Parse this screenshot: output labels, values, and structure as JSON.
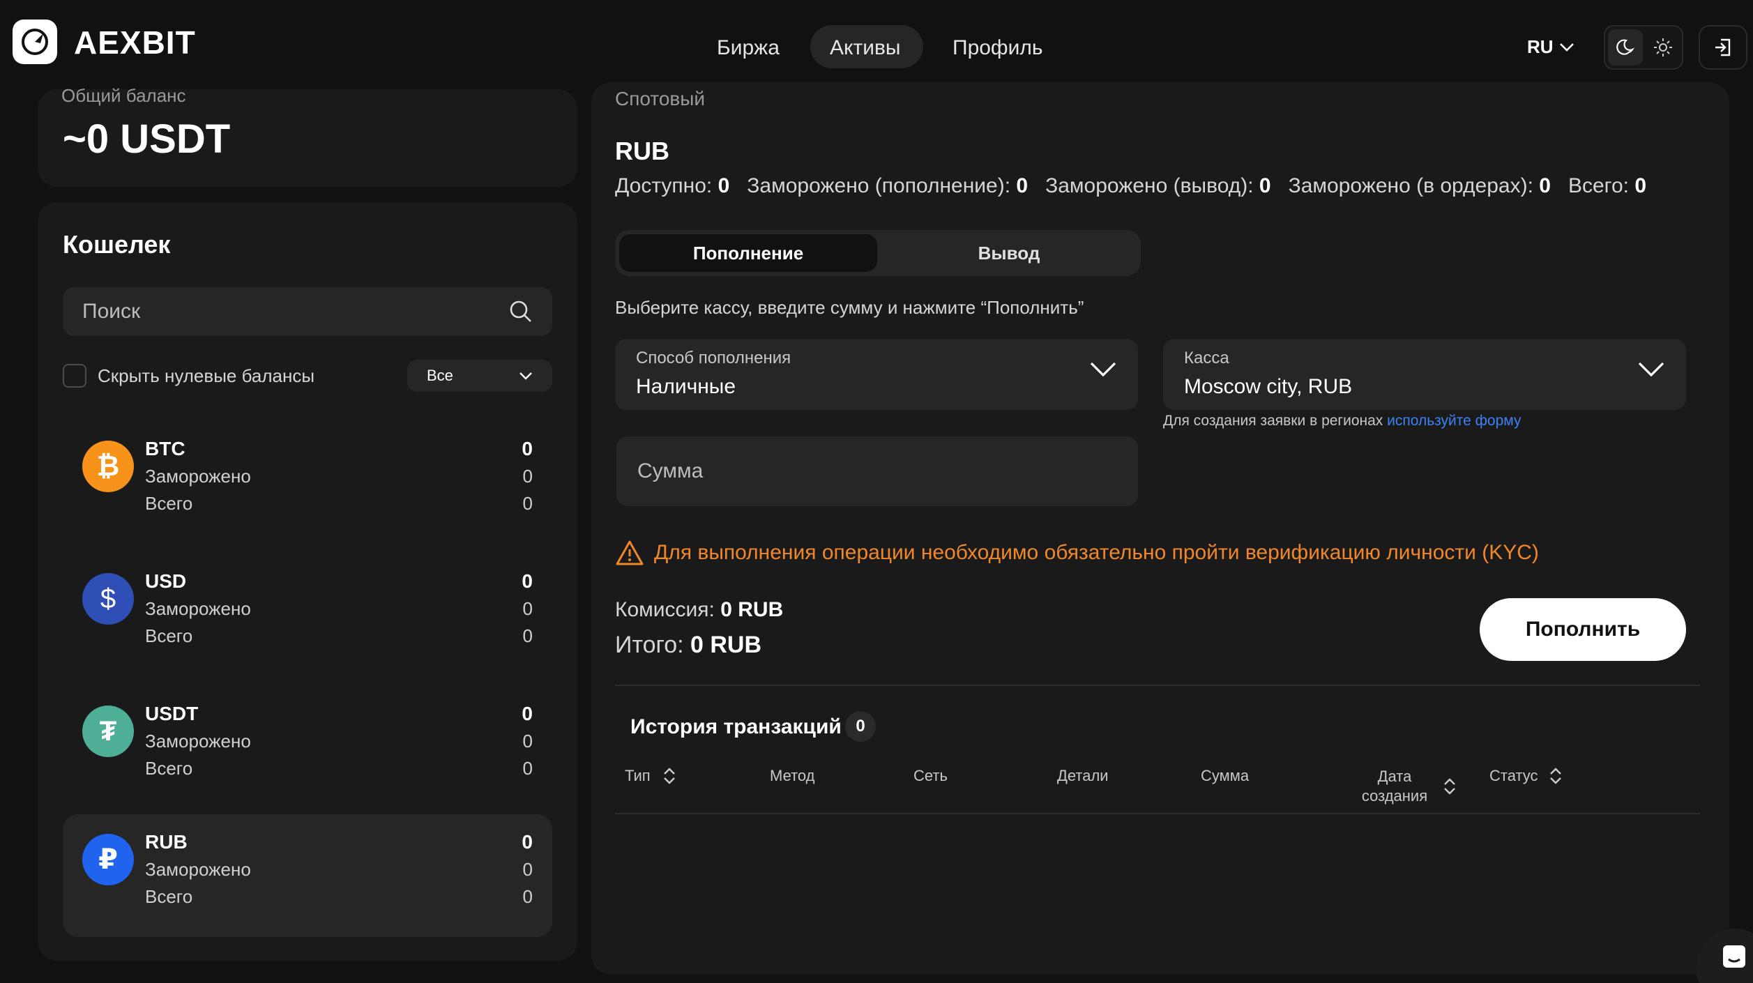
{
  "header": {
    "brand": "AEXBIT",
    "nav": [
      "Биржа",
      "Активы",
      "Профиль"
    ],
    "active_nav": "Активы",
    "lang": "RU"
  },
  "balance": {
    "label": "Общий баланс",
    "value": "~0 USDT"
  },
  "wallet": {
    "title": "Кошелек",
    "search_placeholder": "Поиск",
    "hide_zero": "Скрыть нулевые балансы",
    "filter": "Все",
    "assets": [
      {
        "name": "BTC",
        "frozen_label": "Заморожено",
        "total_label": "Всего",
        "value": "0",
        "frozen": "0",
        "total": "0",
        "color": "#f7931a",
        "icon": "bitcoin-icon"
      },
      {
        "name": "USD",
        "frozen_label": "Заморожено",
        "total_label": "Всего",
        "value": "0",
        "frozen": "0",
        "total": "0",
        "color": "#2f4fb6",
        "icon": "dollar-icon"
      },
      {
        "name": "USDT",
        "frozen_label": "Заморожено",
        "total_label": "Всего",
        "value": "0",
        "frozen": "0",
        "total": "0",
        "color": "#4fae96",
        "icon": "tether-icon"
      },
      {
        "name": "RUB",
        "frozen_label": "Заморожено",
        "total_label": "Всего",
        "value": "0",
        "frozen": "0",
        "total": "0",
        "color": "#1f63ee",
        "icon": "ruble-icon"
      }
    ]
  },
  "main": {
    "section": "Спотовый",
    "currency": "RUB",
    "stats": [
      {
        "label": "Доступно:",
        "value": "0"
      },
      {
        "label": "Заморожено (пополнение):",
        "value": "0"
      },
      {
        "label": "Заморожено (вывод):",
        "value": "0"
      },
      {
        "label": "Заморожено (в ордерах):",
        "value": "0"
      },
      {
        "label": "Всего:",
        "value": "0"
      }
    ],
    "tabs": [
      "Пополнение",
      "Вывод"
    ],
    "hint": "Выберите кассу, введите сумму и нажмите “Пополнить”",
    "method_label": "Способ пополнения",
    "method_value": "Наличные",
    "cashbox_label": "Касса",
    "cashbox_value": "Moscow city, RUB",
    "note_text": "Для создания заявки в регионах",
    "note_link": "используйте форму",
    "amount_placeholder": "Сумма",
    "warning": "Для выполнения операции необходимо обязательно пройти верификацию личности (KYC)",
    "fee_label": "Комиссия:",
    "fee_value": "0 RUB",
    "total_label": "Итого:",
    "total_value": "0 RUB",
    "submit": "Пополнить",
    "history_title": "История транзакций",
    "history_count": "0",
    "columns": [
      "Тип",
      "Метод",
      "Сеть",
      "Детали",
      "Сумма",
      "Дата создания",
      "Статус"
    ],
    "accent_warning": "#f0872a",
    "accent_link": "#3b82f6"
  }
}
